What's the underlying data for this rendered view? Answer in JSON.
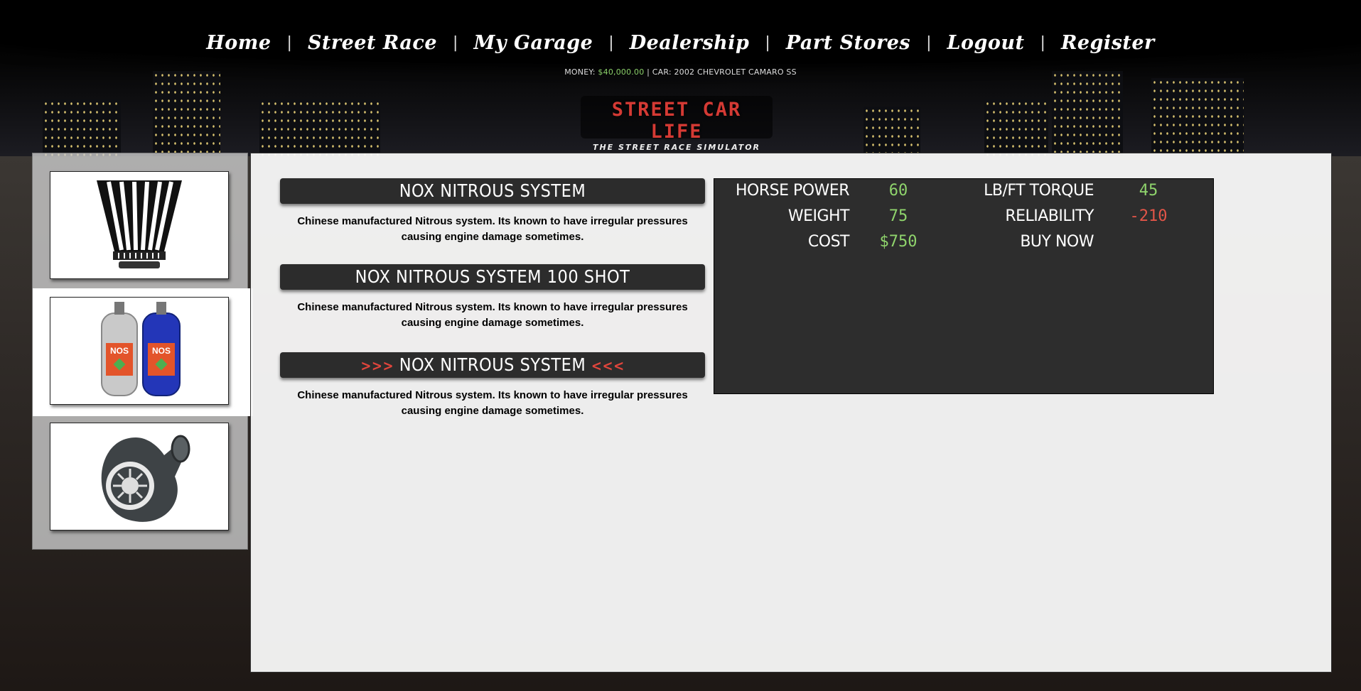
{
  "nav": {
    "items": [
      "Home",
      "Street Race",
      "My Garage",
      "Dealership",
      "Part Stores",
      "Logout",
      "Register"
    ],
    "separator": "|"
  },
  "status": {
    "money_label": "MONEY:",
    "money_value": "$40,000.00",
    "divider": "|",
    "car_label": "CAR:",
    "car_value": "2002 CHEVROLET CAMARO SS"
  },
  "logo": {
    "title": "STREET CAR LIFE",
    "subtitle": "THE STREET RACE SIMULATOR"
  },
  "sidebar": {
    "thumbnails": [
      {
        "icon": "air-filter-icon"
      },
      {
        "icon": "nitrous-bottles-icon",
        "selected": true,
        "bottle_label": "NOS"
      },
      {
        "icon": "turbocharger-icon"
      }
    ]
  },
  "parts": [
    {
      "name": "NOX NITROUS SYSTEM",
      "description": "Chinese manufactured Nitrous system. Its known to have irregular pressures causing engine damage sometimes."
    },
    {
      "name": "NOX NITROUS SYSTEM 100 SHOT",
      "description": "Chinese manufactured Nitrous system. Its known to have irregular pressures causing engine damage sometimes."
    },
    {
      "name": "NOX NITROUS SYSTEM",
      "selected": true,
      "arrow_left": ">>>",
      "arrow_right": "<<<",
      "description": "Chinese manufactured Nitrous system. Its known to have irregular pressures causing engine damage sometimes."
    }
  ],
  "stats": {
    "horsepower_label": "HORSE POWER",
    "horsepower_value": "60",
    "torque_label": "LB/FT TORQUE",
    "torque_value": "45",
    "weight_label": "WEIGHT",
    "weight_value": "75",
    "reliability_label": "RELIABILITY",
    "reliability_value": "-210",
    "cost_label": "COST",
    "cost_value": "$750",
    "buy_label": "BUY NOW"
  },
  "colors": {
    "positive": "#8fd46c",
    "negative": "#e25548",
    "panel": "#2d2d2d"
  }
}
